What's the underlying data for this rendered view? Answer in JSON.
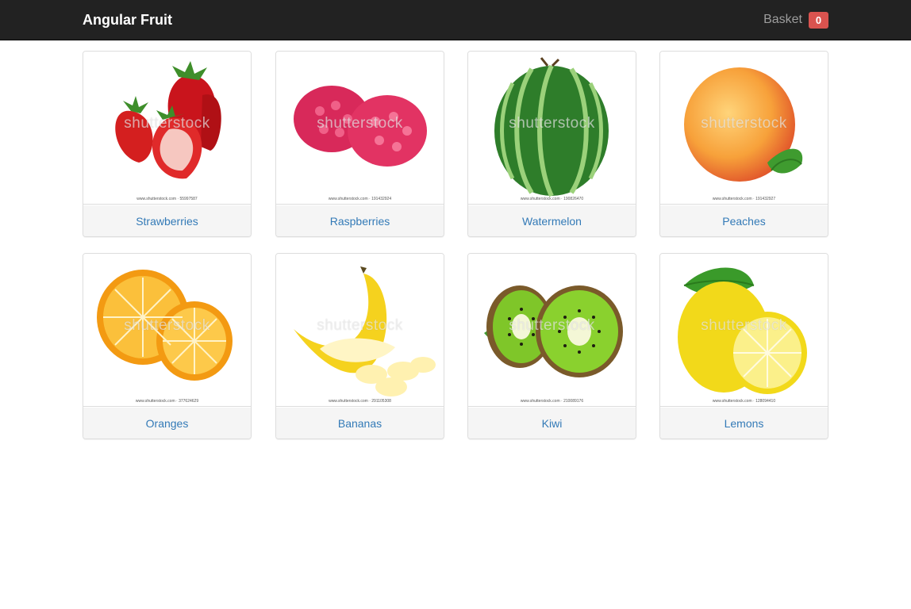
{
  "navbar": {
    "brand": "Angular Fruit",
    "basket_label": "Basket",
    "basket_count": "0"
  },
  "colors": {
    "navbar_bg": "#222222",
    "link": "#337ab7",
    "badge": "#d9534f"
  },
  "products": [
    {
      "name": "Strawberries",
      "image_icon": "strawberry-icon",
      "watermark": "shutterstock",
      "stock_id": "www.shutterstock.com · 55997587"
    },
    {
      "name": "Raspberries",
      "image_icon": "raspberry-icon",
      "watermark": "shutterstock",
      "stock_id": "www.shutterstock.com · 191432924"
    },
    {
      "name": "Watermelon",
      "image_icon": "watermelon-icon",
      "watermark": "shutterstock",
      "stock_id": "www.shutterstock.com · 190826470"
    },
    {
      "name": "Peaches",
      "image_icon": "peach-icon",
      "watermark": "shutterstock",
      "stock_id": "www.shutterstock.com · 191432927"
    },
    {
      "name": "Oranges",
      "image_icon": "orange-icon",
      "watermark": "shutterstock",
      "stock_id": "www.shutterstock.com · 377624629"
    },
    {
      "name": "Bananas",
      "image_icon": "banana-icon",
      "watermark": "shutterstock",
      "stock_id": "www.shutterstock.com · 291105308"
    },
    {
      "name": "Kiwi",
      "image_icon": "kiwi-icon",
      "watermark": "shutterstock",
      "stock_id": "www.shutterstock.com · 210089176"
    },
    {
      "name": "Lemons",
      "image_icon": "lemon-icon",
      "watermark": "shutterstock",
      "stock_id": "www.shutterstock.com · 128094410"
    }
  ]
}
